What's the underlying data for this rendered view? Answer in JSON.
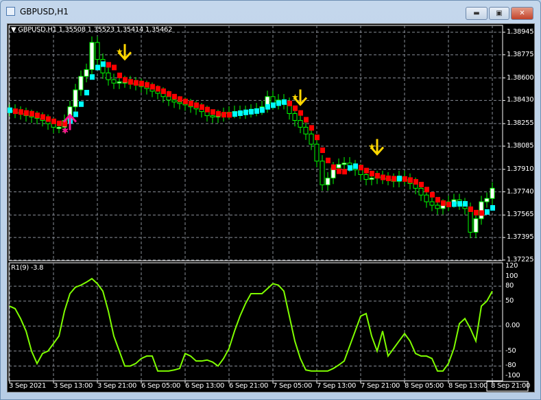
{
  "window": {
    "title": "GBPUSD,H1",
    "minimize_icon": "minimize-icon",
    "maximize_icon": "restore-icon",
    "close_icon": "close-icon"
  },
  "chart_data": [
    {
      "type": "candlestick",
      "title": "GBPUSD,H1  1.35508 1.35523 1.35414 1.35462",
      "y_ticks": [
        "1.38945",
        "1.38775",
        "1.38600",
        "1.38430",
        "1.38255",
        "1.38085",
        "1.37910",
        "1.37740",
        "1.37565",
        "1.37395",
        "1.37225"
      ],
      "ylim": [
        1.37225,
        1.38945
      ],
      "x_ticks": [
        "3 Sep 2021",
        "3 Sep 13:00",
        "3 Sep 21:00",
        "6 Sep 05:00",
        "6 Sep 13:00",
        "6 Sep 21:00",
        "7 Sep 05:00",
        "7 Sep 13:00",
        "7 Sep 21:00",
        "8 Sep 05:00",
        "8 Sep 13:00",
        "8 Sep 21:00"
      ],
      "grid": true,
      "colors": {
        "bull_body": "#ffffff",
        "candle_outline": "#00ff00",
        "trend_up": "#00ffff",
        "trend_down": "#ff0000",
        "sell_signal": "#ffd700",
        "buy_signal": "#ff1493"
      },
      "closes": [
        1.38356,
        1.38341,
        1.38331,
        1.38315,
        1.38305,
        1.38295,
        1.38279,
        1.38254,
        1.38228,
        1.38228,
        1.38279,
        1.38382,
        1.3851,
        1.38612,
        1.38663,
        1.38868,
        1.3874,
        1.38638,
        1.38587,
        1.38561,
        1.38571,
        1.38571,
        1.38561,
        1.38551,
        1.38535,
        1.3852,
        1.385,
        1.38484,
        1.38459,
        1.38433,
        1.38418,
        1.38407,
        1.38397,
        1.38382,
        1.38366,
        1.38346,
        1.38315,
        1.38305,
        1.38315,
        1.38331,
        1.38341,
        1.38346,
        1.38336,
        1.38346,
        1.38356,
        1.38366,
        1.38382,
        1.38459,
        1.38407,
        1.38433,
        1.38407,
        1.38331,
        1.38279,
        1.38228,
        1.38177,
        1.381,
        1.37972,
        1.37793,
        1.37844,
        1.37921,
        1.37947,
        1.37957,
        1.37936,
        1.37906,
        1.3787,
        1.37834,
        1.37844,
        1.37854,
        1.37844,
        1.37834,
        1.37819,
        1.37854,
        1.37834,
        1.37803,
        1.37767,
        1.37716,
        1.37665,
        1.37639,
        1.37614,
        1.37639,
        1.37665,
        1.3768,
        1.37649,
        1.37614,
        1.37435,
        1.37537,
        1.37665,
        1.3769,
        1.37767
      ],
      "signals": [
        {
          "type": "buy",
          "candle": 11
        },
        {
          "type": "sell",
          "candle": 21
        },
        {
          "type": "sell",
          "candle": 53
        },
        {
          "type": "sell",
          "candle": 67
        }
      ]
    },
    {
      "type": "line",
      "title": "R1(9) -3.8",
      "y_ticks": [
        "120",
        "100",
        "80",
        "50",
        "0.00",
        "-50",
        "-80",
        "-100"
      ],
      "y_tick_values": [
        120,
        100,
        80,
        50,
        0,
        -50,
        -80,
        -100
      ],
      "ylim": [
        -100,
        120
      ],
      "levels": [
        80,
        50,
        0,
        -50,
        -80
      ],
      "color": "#7fff00",
      "values": [
        40,
        35,
        15,
        -10,
        -50,
        -75,
        -55,
        -50,
        -35,
        -20,
        30,
        65,
        78,
        82,
        88,
        95,
        85,
        70,
        30,
        -20,
        -50,
        -80,
        -80,
        -75,
        -65,
        -60,
        -60,
        -90,
        -90,
        -90,
        -88,
        -85,
        -55,
        -60,
        -70,
        -70,
        -68,
        -72,
        -80,
        -65,
        -45,
        -10,
        20,
        45,
        65,
        65,
        65,
        75,
        85,
        82,
        70,
        20,
        -30,
        -65,
        -88,
        -90,
        -90,
        -90,
        -90,
        -85,
        -78,
        -70,
        -40,
        -10,
        20,
        25,
        -20,
        -50,
        -10,
        -60,
        -45,
        -30,
        -15,
        -30,
        -55,
        -60,
        -60,
        -65,
        -90,
        -90,
        -75,
        -45,
        5,
        15,
        -5,
        -30,
        40,
        50,
        70
      ]
    }
  ]
}
